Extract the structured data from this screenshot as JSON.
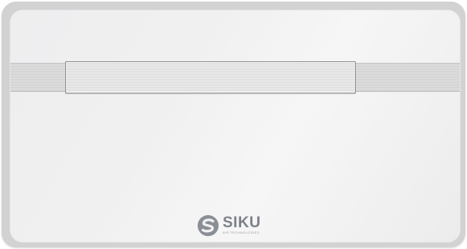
{
  "product": {
    "brand_name": "SIKU",
    "brand_tagline": "AIR TECHNOLOGIES"
  },
  "colors": {
    "panel": "#f0f0f1",
    "frame": "#d2d2d3",
    "logo": "#7d8189"
  },
  "icons": {
    "brand_logo": "siku-s-logo-icon"
  }
}
